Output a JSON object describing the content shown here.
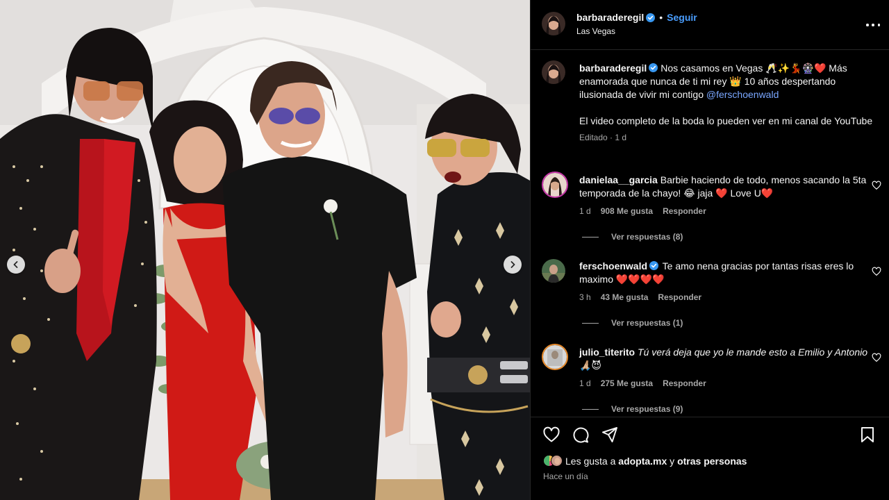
{
  "post": {
    "username": "barbaraderegil",
    "follow_label": "Seguir",
    "location": "Las Vegas",
    "more_label": "Más opciones"
  },
  "caption": {
    "username": "barbaraderegil",
    "text": "Nos casamos en Vegas 🥂✨💃🎡❤️ Más enamorada que nunca de ti mi rey 👑 10 años despertando ilusionada de vivir mi contigo ",
    "mention": "@ferschoenwald",
    "text2": "El video completo de la boda lo pueden ver en mi canal de YouTube",
    "edited": "Editado",
    "time": "1 d",
    "separator": " · "
  },
  "comments": [
    {
      "username": "danielaa__garcia",
      "text": " Barbie haciendo de todo, menos sacando la 5ta temporada de la chayo! 😂 jaja ❤️ Love U❤️",
      "time": "1 d",
      "likes": "908 Me gusta",
      "reply": "Responder",
      "view_replies": "Ver respuestas (8)"
    },
    {
      "username": "ferschoenwald",
      "text": " Te amo nena gracias por tantas risas eres lo maximo ❤️❤️❤️❤️",
      "time": "3 h",
      "likes": "43 Me gusta",
      "reply": "Responder",
      "view_replies": "Ver respuestas (1)"
    },
    {
      "username": "julio_titerito",
      "text": " Tú verá deja que yo le mande esto a Emilio y Antonio 🙏🏼😈",
      "time": "1 d",
      "likes": "275 Me gusta",
      "reply": "Responder",
      "view_replies": "Ver respuestas (9)"
    }
  ],
  "footer": {
    "likes_prefix": "Les gusta a ",
    "likes_user": "adopta.mx",
    "likes_mid": " y ",
    "likes_others": "otras personas",
    "ago": "Hace un día"
  },
  "icons": {
    "like": "heart-icon",
    "comment": "comment-icon",
    "share": "share-icon",
    "save": "bookmark-icon",
    "verified": "verified-badge-icon",
    "prev": "chevron-left-icon",
    "next": "chevron-right-icon"
  },
  "colors": {
    "accent": "#4a9eff",
    "mention": "#7aa7ff",
    "muted": "#a8a8a8",
    "background": "#000000"
  }
}
